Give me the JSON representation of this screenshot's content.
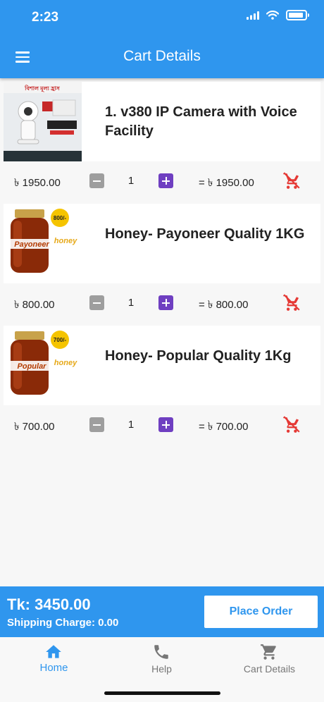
{
  "status_bar": {
    "time": "2:23"
  },
  "app_bar": {
    "title": "Cart Details",
    "menu_icon": "hamburger-icon"
  },
  "cart_items": [
    {
      "name": "1. v380 IP Camera with Voice Facility",
      "thumb_text": "বিশাল মূল্য হ্রাস",
      "unit_price": "৳ 1950.00",
      "quantity": "1",
      "subtotal": "= ৳ 1950.00"
    },
    {
      "name": "Honey- Payoneer Quality 1KG",
      "thumb_text": "Payoneer",
      "price_tag": "800/-",
      "unit_price": "৳ 800.00",
      "quantity": "1",
      "subtotal": "= ৳ 800.00"
    },
    {
      "name": "Honey- Popular Quality 1Kg",
      "thumb_text": "Popular",
      "price_tag": "700/-",
      "unit_price": "৳ 700.00",
      "quantity": "1",
      "subtotal": "= ৳ 700.00"
    }
  ],
  "summary": {
    "total": "Tk: 3450.00",
    "shipping": "Shipping Charge: 0.00",
    "place_order": "Place Order"
  },
  "bottom_nav": {
    "items": [
      {
        "label": "Home",
        "icon": "home-icon",
        "active": true
      },
      {
        "label": "Help",
        "icon": "phone-icon",
        "active": false
      },
      {
        "label": "Cart Details",
        "icon": "cart-icon",
        "active": false
      }
    ]
  },
  "colors": {
    "primary": "#2f96ee",
    "plus_button": "#6f3fc1",
    "minus_button": "#9e9e9e",
    "remove_red": "#e53935"
  }
}
